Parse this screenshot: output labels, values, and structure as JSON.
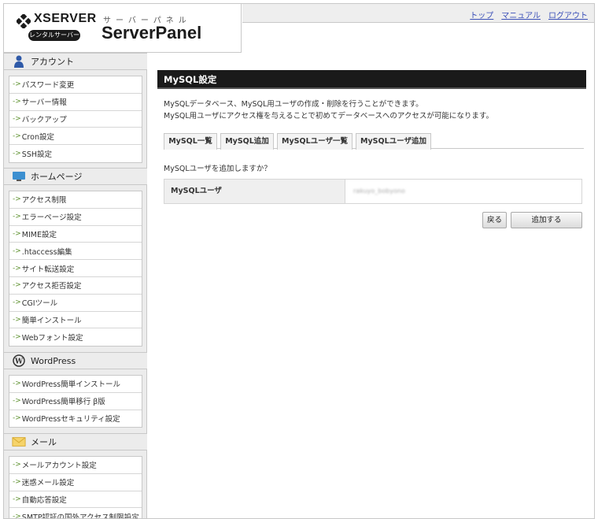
{
  "header": {
    "brand": "XSERVER",
    "badge": "レンタルサーバー",
    "subtitle": "サーバーパネル",
    "title": "ServerPanel",
    "links": [
      "トップ",
      "マニュアル",
      "ログアウト"
    ]
  },
  "sidebar": {
    "sections": [
      {
        "title": "アカウント",
        "icon": "person-icon",
        "items": [
          "パスワード変更",
          "サーバー情報",
          "バックアップ",
          "Cron設定",
          "SSH設定"
        ]
      },
      {
        "title": "ホームページ",
        "icon": "monitor-icon",
        "items": [
          "アクセス制限",
          "エラーページ設定",
          "MIME設定",
          ".htaccess編集",
          "サイト転送設定",
          "アクセス拒否設定",
          "CGIツール",
          "簡単インストール",
          "Webフォント設定"
        ]
      },
      {
        "title": "WordPress",
        "icon": "wordpress-icon",
        "items": [
          "WordPress簡単インストール",
          "WordPress簡単移行 β版",
          "WordPressセキュリティ設定"
        ]
      },
      {
        "title": "メール",
        "icon": "envelope-icon",
        "items": [
          "メールアカウント設定",
          "迷惑メール設定",
          "自動応答設定",
          "SMTP認証の国外アクセス制限設定"
        ]
      }
    ]
  },
  "main": {
    "title": "MySQL設定",
    "desc1": "MySQLデータベース、MySQL用ユーザの作成・削除を行うことができます。",
    "desc2": "MySQL用ユーザにアクセス権を与えることで初めてデータベースへのアクセスが可能になります。",
    "tabs": [
      "MySQL一覧",
      "MySQL追加",
      "MySQLユーザ一覧",
      "MySQLユーザ追加"
    ],
    "prompt": "MySQLユーザを追加しますか？",
    "form_label": "MySQLユーザ",
    "form_value": "rakuyo_bobyono",
    "back_button": "戻る",
    "add_button": "追加する"
  }
}
